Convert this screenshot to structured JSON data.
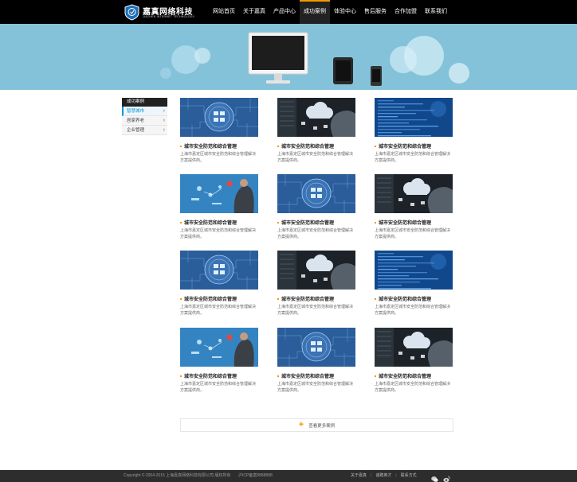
{
  "brand": {
    "title": "嘉真网络科技",
    "subtitle": "JIAZHEN INTERNET TECHNOLOGY"
  },
  "nav": {
    "items": [
      {
        "label": "网站首页"
      },
      {
        "label": "关于嘉真"
      },
      {
        "label": "产品中心"
      },
      {
        "label": "成功案例",
        "active": true
      },
      {
        "label": "体验中心"
      },
      {
        "label": "售后服务"
      },
      {
        "label": "合作加盟"
      },
      {
        "label": "联系我们"
      }
    ]
  },
  "sidebar": {
    "title": "成功案例",
    "items": [
      {
        "label": "智慧城市",
        "active": true
      },
      {
        "label": "居家养老"
      },
      {
        "label": "企业管理"
      }
    ]
  },
  "cases": [
    {
      "image": "circuit-icons",
      "title": "城市安全防范和综合管理",
      "desc": "上海市嘉定区城市安全防范和综合管理解决方案提供商。"
    },
    {
      "image": "cloud-hand",
      "title": "城市安全防范和综合管理",
      "desc": "上海市嘉定区城市安全防范和综合管理解决方案提供商。"
    },
    {
      "image": "code-screen",
      "title": "城市安全防范和综合管理",
      "desc": "上海市嘉定区城市安全防范和综合管理解决方案提供商。"
    },
    {
      "image": "businessman-touch",
      "title": "城市安全防范和综合管理",
      "desc": "上海市嘉定区城市安全防范和综合管理解决方案提供商。"
    },
    {
      "image": "circuit-icons",
      "title": "城市安全防范和综合管理",
      "desc": "上海市嘉定区城市安全防范和综合管理解决方案提供商。"
    },
    {
      "image": "cloud-hand",
      "title": "城市安全防范和综合管理",
      "desc": "上海市嘉定区城市安全防范和综合管理解决方案提供商。"
    },
    {
      "image": "circuit-icons",
      "title": "城市安全防范和综合管理",
      "desc": "上海市嘉定区城市安全防范和综合管理解决方案提供商。"
    },
    {
      "image": "cloud-hand",
      "title": "城市安全防范和综合管理",
      "desc": "上海市嘉定区城市安全防范和综合管理解决方案提供商。"
    },
    {
      "image": "code-screen",
      "title": "城市安全防范和综合管理",
      "desc": "上海市嘉定区城市安全防范和综合管理解决方案提供商。"
    },
    {
      "image": "businessman-touch",
      "title": "城市安全防范和综合管理",
      "desc": "上海市嘉定区城市安全防范和综合管理解决方案提供商。"
    },
    {
      "image": "circuit-icons",
      "title": "城市安全防范和综合管理",
      "desc": "上海市嘉定区城市安全防范和综合管理解决方案提供商。"
    },
    {
      "image": "cloud-hand",
      "title": "城市安全防范和综合管理",
      "desc": "上海市嘉定区城市安全防范和综合管理解决方案提供商。"
    }
  ],
  "more": {
    "label": "查看更多案例",
    "icon": "plus-icon"
  },
  "footer": {
    "copyright": "Copyright © 2004-2015 上海嘉真网络科技有限公司 版权所有",
    "icp": "沪ICP备案8888888",
    "links": [
      {
        "label": "关于嘉真"
      },
      {
        "label": "诚聘英才"
      },
      {
        "label": "联系方式"
      }
    ],
    "social": [
      "wechat-icon",
      "weibo-icon"
    ]
  },
  "colors": {
    "accent": "#f39800",
    "link_blue": "#0095d9",
    "banner": "#84c2da",
    "header": "#000000",
    "footer": "#2d2d2d"
  }
}
